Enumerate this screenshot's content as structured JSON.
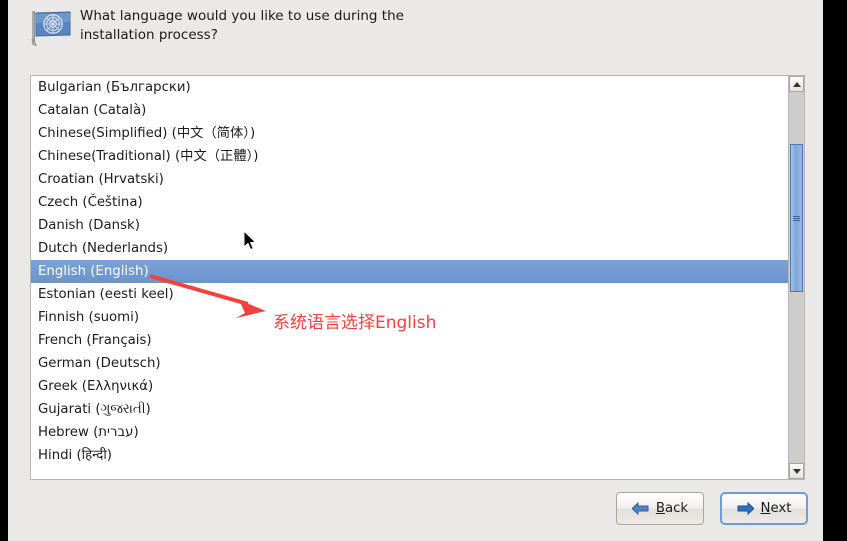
{
  "header": {
    "icon": "un-flag-icon",
    "question_line1": "What language would you like to use during the",
    "question_line2": "installation process?"
  },
  "language_list": {
    "name": "language-selection-list",
    "selected": "English (English)",
    "items": [
      {
        "label": "Bulgarian (Български)",
        "selected": false
      },
      {
        "label": "Catalan (Català)",
        "selected": false
      },
      {
        "label": "Chinese(Simplified) (中文（简体）)",
        "selected": false
      },
      {
        "label": "Chinese(Traditional) (中文（正體）)",
        "selected": false
      },
      {
        "label": "Croatian (Hrvatski)",
        "selected": false
      },
      {
        "label": "Czech (Čeština)",
        "selected": false
      },
      {
        "label": "Danish (Dansk)",
        "selected": false
      },
      {
        "label": "Dutch (Nederlands)",
        "selected": false
      },
      {
        "label": "English (English)",
        "selected": true
      },
      {
        "label": "Estonian (eesti keel)",
        "selected": false
      },
      {
        "label": "Finnish (suomi)",
        "selected": false
      },
      {
        "label": "French (Français)",
        "selected": false
      },
      {
        "label": "German (Deutsch)",
        "selected": false
      },
      {
        "label": "Greek (Ελληνικά)",
        "selected": false
      },
      {
        "label": "Gujarati (ગુજરાતી)",
        "selected": false
      },
      {
        "label": "Hebrew (עברית)",
        "selected": false
      },
      {
        "label": "Hindi (हिन्दी)",
        "selected": false
      }
    ]
  },
  "scrollbar": {
    "up_arrow": "chevron-up-icon",
    "down_arrow": "chevron-down-icon",
    "thumb": "scrollbar-thumb"
  },
  "annotation": {
    "text": "系统语言选择English",
    "color": "#f4413c",
    "arrow": "red-arrow-pointing-to-selected-language"
  },
  "footer": {
    "back_label": "Back",
    "back_mnemonic": "B",
    "back_rest": "ack",
    "next_label": "Next",
    "next_mnemonic": "N",
    "next_rest": "ext"
  },
  "colors": {
    "panel_background": "#ebe9e7",
    "list_background": "#ffffff",
    "selection_blue": "#6f9ad3",
    "focus_blue": "#6f9ad3",
    "annotation_red": "#f4413c"
  }
}
